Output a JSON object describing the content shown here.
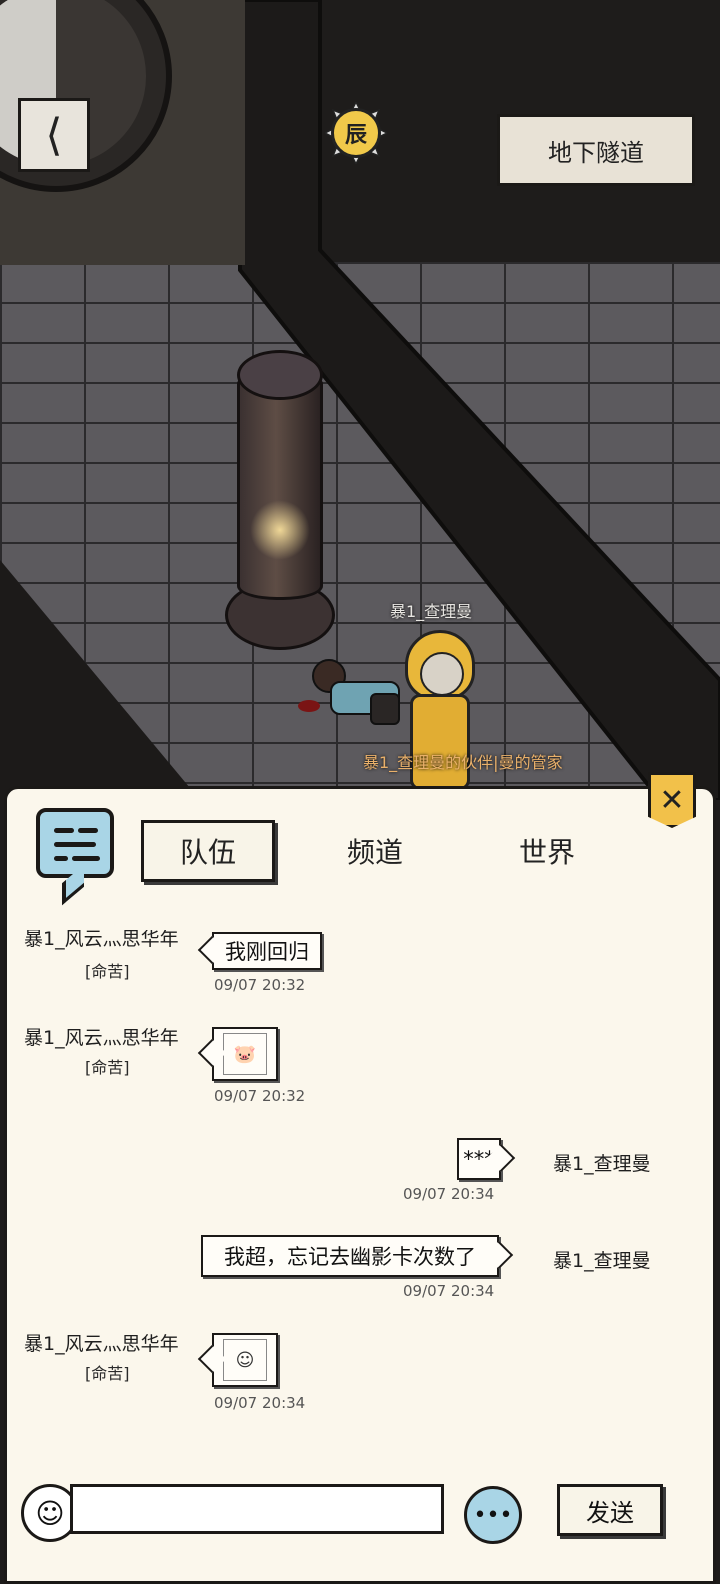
{
  "scene": {
    "back_icon": "back-arrow-icon",
    "time_badge": "辰",
    "location": "地下隧道",
    "npc_name": "暴1_查理曼",
    "npc_subtitle": "暴1_查理曼的伙伴|曼的管家"
  },
  "chat": {
    "tabs": [
      "队伍",
      "频道",
      "世界"
    ],
    "active_tab": "队伍",
    "messages": [
      {
        "sender": "暴1_风云灬思华年",
        "rank": "[命苦]",
        "content": "我刚回归",
        "time": "09/07 20:32"
      },
      {
        "sender": "暴1_风云灬思华年",
        "rank": "[命苦]",
        "content": "pig-face-sticker",
        "time": "09/07 20:32"
      },
      {
        "sender": "暴1_查理曼",
        "rank": "",
        "content": "***",
        "time": "09/07 20:34"
      },
      {
        "sender": "暴1_查理曼",
        "rank": "",
        "content": "我超，忘记去幽影卡次数了",
        "time": "09/07 20:34"
      },
      {
        "sender": "暴1_风云灬思华年",
        "rank": "[命苦]",
        "content": "funny-face-sticker",
        "time": "09/07 20:34"
      }
    ],
    "input_value": "",
    "send_label": "发送",
    "close_icon": "close-icon"
  },
  "colors": {
    "panel_bg": "#fbf7ec",
    "accent_yellow": "#f2c14a",
    "accent_blue": "#a9d5e6",
    "npc_subtitle": "#e9b06a"
  }
}
